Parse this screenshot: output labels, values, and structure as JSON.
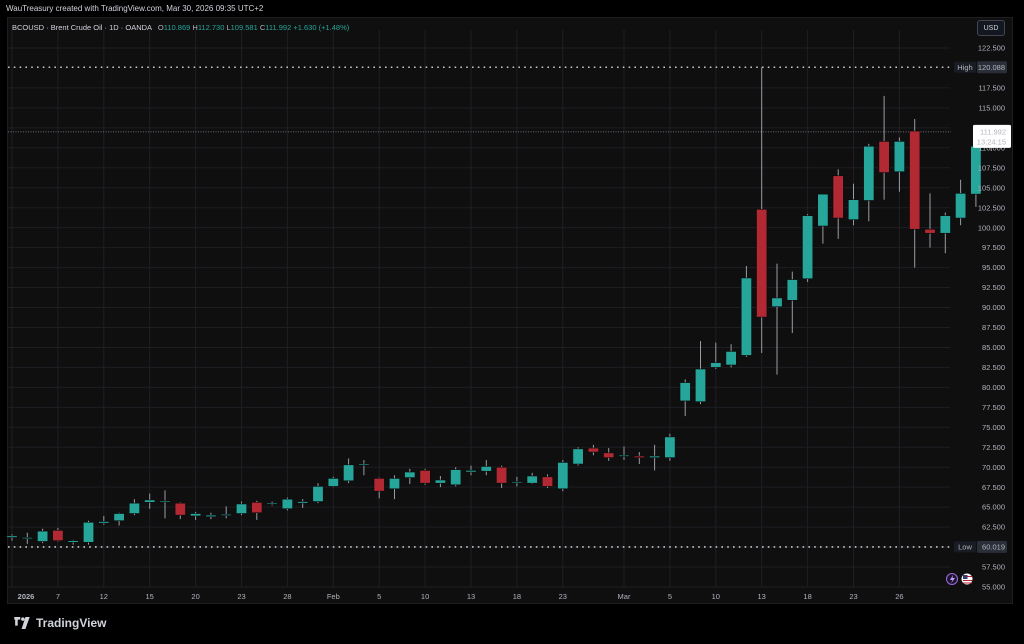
{
  "header": {
    "credit": "WauTreasury created with TradingView.com, Mar 30, 2026 09:35 UTC+2"
  },
  "legend": {
    "symbol": "BCOUSD · Brent Crude Oil · 1D · OANDA",
    "o_label": "O",
    "o": "110.869",
    "h_label": "H",
    "h": "112.730",
    "l_label": "L",
    "l": "109.581",
    "c_label": "C",
    "c": "111.992",
    "change": "+1.630 (+1.48%)"
  },
  "toolbar": {
    "currency": "USD"
  },
  "footer": {
    "brand": "TradingView"
  },
  "colors": {
    "up": "#26a69a",
    "down": "#b22833",
    "grid": "#1f1f23",
    "background": "#0f0f10"
  },
  "icons": [
    "lightning-icon",
    "us-flag-icon",
    "tradingview-logo-icon"
  ],
  "chart_data": {
    "type": "candlestick",
    "symbol": "BCOUSD",
    "ylim": [
      55.0,
      123.5
    ],
    "y_ticks": [
      "55.000",
      "57.500",
      "60.000",
      "62.500",
      "65.000",
      "67.500",
      "70.000",
      "72.500",
      "75.000",
      "77.500",
      "80.000",
      "82.500",
      "85.000",
      "87.500",
      "90.000",
      "92.500",
      "95.000",
      "97.500",
      "100.000",
      "102.500",
      "105.000",
      "107.500",
      "110.000",
      "112.500",
      "115.000",
      "117.500",
      "122.500"
    ],
    "x_ticks": [
      {
        "label": "2026",
        "index": 0,
        "bold": true
      },
      {
        "label": "7",
        "index": 3
      },
      {
        "label": "12",
        "index": 6
      },
      {
        "label": "15",
        "index": 9
      },
      {
        "label": "20",
        "index": 12
      },
      {
        "label": "23",
        "index": 15
      },
      {
        "label": "28",
        "index": 18
      },
      {
        "label": "Feb",
        "index": 21
      },
      {
        "label": "5",
        "index": 24
      },
      {
        "label": "10",
        "index": 27
      },
      {
        "label": "13",
        "index": 30
      },
      {
        "label": "18",
        "index": 33
      },
      {
        "label": "23",
        "index": 36
      },
      {
        "label": "Mar",
        "index": 40
      },
      {
        "label": "5",
        "index": 43
      },
      {
        "label": "10",
        "index": 46
      },
      {
        "label": "13",
        "index": 49
      },
      {
        "label": "18",
        "index": 52
      },
      {
        "label": "23",
        "index": 55
      },
      {
        "label": "26",
        "index": 58
      }
    ],
    "high_marker": {
      "label": "High",
      "value": "120.088",
      "y": 120.088
    },
    "low_marker": {
      "label": "Low",
      "value": "60.019",
      "y": 60.019
    },
    "last_price": {
      "value": "111.992",
      "countdown": "13:24:15",
      "y": 111.992
    },
    "candles": [
      {
        "o": 61.2,
        "h": 61.6,
        "l": 60.8,
        "c": 61.4
      },
      {
        "o": 61.1,
        "h": 61.8,
        "l": 60.4,
        "c": 61.2
      },
      {
        "o": 60.7,
        "h": 62.3,
        "l": 60.5,
        "c": 62.0
      },
      {
        "o": 62.1,
        "h": 62.4,
        "l": 60.7,
        "c": 60.8
      },
      {
        "o": 60.6,
        "h": 60.9,
        "l": 60.3,
        "c": 60.8
      },
      {
        "o": 60.6,
        "h": 63.3,
        "l": 60.3,
        "c": 63.1
      },
      {
        "o": 63.0,
        "h": 63.9,
        "l": 62.8,
        "c": 63.2
      },
      {
        "o": 63.3,
        "h": 64.3,
        "l": 62.7,
        "c": 64.2
      },
      {
        "o": 64.2,
        "h": 66.0,
        "l": 64.0,
        "c": 65.5
      },
      {
        "o": 65.6,
        "h": 66.7,
        "l": 64.8,
        "c": 65.9
      },
      {
        "o": 65.8,
        "h": 67.1,
        "l": 63.6,
        "c": 65.8
      },
      {
        "o": 65.5,
        "h": 65.6,
        "l": 63.5,
        "c": 64.0
      },
      {
        "o": 63.9,
        "h": 64.4,
        "l": 63.4,
        "c": 64.2
      },
      {
        "o": 63.8,
        "h": 64.3,
        "l": 63.5,
        "c": 64.0
      },
      {
        "o": 64.0,
        "h": 65.1,
        "l": 63.6,
        "c": 64.1
      },
      {
        "o": 64.2,
        "h": 65.7,
        "l": 64.0,
        "c": 65.4
      },
      {
        "o": 65.6,
        "h": 65.8,
        "l": 63.4,
        "c": 64.3
      },
      {
        "o": 65.5,
        "h": 65.7,
        "l": 65.2,
        "c": 65.5
      },
      {
        "o": 64.8,
        "h": 66.2,
        "l": 64.6,
        "c": 66.0
      },
      {
        "o": 65.5,
        "h": 66.0,
        "l": 64.9,
        "c": 65.7
      },
      {
        "o": 65.7,
        "h": 68.0,
        "l": 65.5,
        "c": 67.6
      },
      {
        "o": 67.6,
        "h": 68.8,
        "l": 67.5,
        "c": 68.6
      },
      {
        "o": 68.3,
        "h": 71.1,
        "l": 68.0,
        "c": 70.3
      },
      {
        "o": 70.3,
        "h": 70.9,
        "l": 69.0,
        "c": 70.4
      },
      {
        "o": 68.6,
        "h": 68.7,
        "l": 66.1,
        "c": 67.0
      },
      {
        "o": 67.3,
        "h": 69.0,
        "l": 66.0,
        "c": 68.6
      },
      {
        "o": 68.7,
        "h": 69.8,
        "l": 67.9,
        "c": 69.4
      },
      {
        "o": 69.6,
        "h": 69.8,
        "l": 67.8,
        "c": 68.0
      },
      {
        "o": 68.0,
        "h": 68.9,
        "l": 67.5,
        "c": 68.4
      },
      {
        "o": 67.8,
        "h": 70.0,
        "l": 67.6,
        "c": 69.7
      },
      {
        "o": 69.4,
        "h": 70.2,
        "l": 69.0,
        "c": 69.6
      },
      {
        "o": 69.5,
        "h": 70.9,
        "l": 69.0,
        "c": 70.1
      },
      {
        "o": 70.0,
        "h": 70.2,
        "l": 67.4,
        "c": 68.0
      },
      {
        "o": 68.2,
        "h": 68.8,
        "l": 67.6,
        "c": 68.2
      },
      {
        "o": 68.0,
        "h": 69.3,
        "l": 67.9,
        "c": 68.9
      },
      {
        "o": 68.8,
        "h": 69.1,
        "l": 67.4,
        "c": 67.6
      },
      {
        "o": 67.3,
        "h": 70.9,
        "l": 67.0,
        "c": 70.6
      },
      {
        "o": 70.4,
        "h": 72.5,
        "l": 70.2,
        "c": 72.3
      },
      {
        "o": 72.4,
        "h": 72.8,
        "l": 71.5,
        "c": 71.9
      },
      {
        "o": 71.8,
        "h": 72.4,
        "l": 70.8,
        "c": 71.2
      },
      {
        "o": 71.4,
        "h": 72.6,
        "l": 70.9,
        "c": 71.5
      },
      {
        "o": 71.4,
        "h": 71.9,
        "l": 70.4,
        "c": 71.2
      },
      {
        "o": 71.2,
        "h": 72.8,
        "l": 69.6,
        "c": 71.4
      },
      {
        "o": 71.2,
        "h": 74.2,
        "l": 70.8,
        "c": 73.8
      },
      {
        "o": 78.3,
        "h": 81.0,
        "l": 76.4,
        "c": 80.6
      },
      {
        "o": 78.2,
        "h": 85.8,
        "l": 77.9,
        "c": 82.3
      },
      {
        "o": 82.5,
        "h": 85.6,
        "l": 82.3,
        "c": 83.1
      },
      {
        "o": 82.8,
        "h": 85.4,
        "l": 82.5,
        "c": 84.5
      },
      {
        "o": 84.0,
        "h": 95.2,
        "l": 83.8,
        "c": 93.7
      },
      {
        "o": 102.3,
        "h": 120.088,
        "l": 84.3,
        "c": 88.8
      },
      {
        "o": 90.1,
        "h": 95.5,
        "l": 81.6,
        "c": 91.2
      },
      {
        "o": 90.9,
        "h": 94.5,
        "l": 86.8,
        "c": 93.5
      },
      {
        "o": 93.6,
        "h": 101.7,
        "l": 93.2,
        "c": 101.5
      },
      {
        "o": 100.2,
        "h": 104.0,
        "l": 98.0,
        "c": 104.2
      },
      {
        "o": 106.5,
        "h": 107.3,
        "l": 98.6,
        "c": 101.2
      },
      {
        "o": 101.0,
        "h": 105.5,
        "l": 100.3,
        "c": 103.5
      },
      {
        "o": 103.4,
        "h": 110.5,
        "l": 100.8,
        "c": 110.2
      },
      {
        "o": 110.8,
        "h": 116.5,
        "l": 103.5,
        "c": 106.9
      },
      {
        "o": 107.0,
        "h": 111.3,
        "l": 104.5,
        "c": 110.8
      },
      {
        "o": 112.1,
        "h": 113.6,
        "l": 95.0,
        "c": 99.8
      },
      {
        "o": 99.8,
        "h": 104.3,
        "l": 97.5,
        "c": 99.3
      },
      {
        "o": 99.3,
        "h": 101.9,
        "l": 96.8,
        "c": 101.5
      },
      {
        "o": 101.2,
        "h": 106.0,
        "l": 100.3,
        "c": 104.3
      },
      {
        "o": 104.2,
        "h": 110.5,
        "l": 102.6,
        "c": 110.2
      },
      {
        "o": 110.9,
        "h": 112.7,
        "l": 109.6,
        "c": 111.99
      }
    ]
  }
}
